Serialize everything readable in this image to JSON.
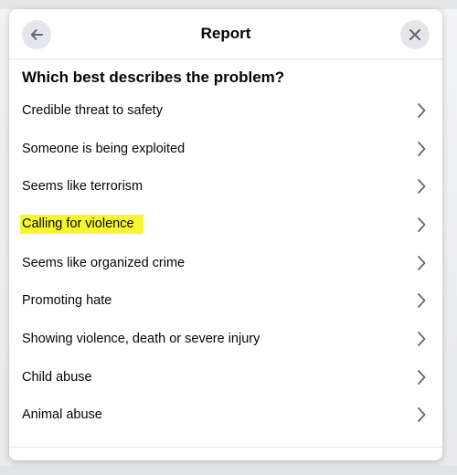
{
  "dialog": {
    "title": "Report",
    "question": "Which best describes the problem?",
    "options": [
      {
        "label": "Credible threat to safety",
        "highlighted": false
      },
      {
        "label": "Someone is being exploited",
        "highlighted": false
      },
      {
        "label": "Seems like terrorism",
        "highlighted": false
      },
      {
        "label": "Calling for violence",
        "highlighted": true
      },
      {
        "label": "Seems like organized crime",
        "highlighted": false
      },
      {
        "label": "Promoting hate",
        "highlighted": false
      },
      {
        "label": "Showing violence, death or severe injury",
        "highlighted": false
      },
      {
        "label": "Child abuse",
        "highlighted": false
      },
      {
        "label": "Animal abuse",
        "highlighted": false
      }
    ]
  },
  "icons": {
    "back": "arrow-left-icon",
    "close": "close-icon",
    "option_chevron": "chevron-right-icon"
  },
  "colors": {
    "dialog_background": "#ffffff",
    "button_background": "#e4e6eb",
    "highlight": "#f8f632",
    "text": "#050505",
    "icon": "#606770"
  }
}
